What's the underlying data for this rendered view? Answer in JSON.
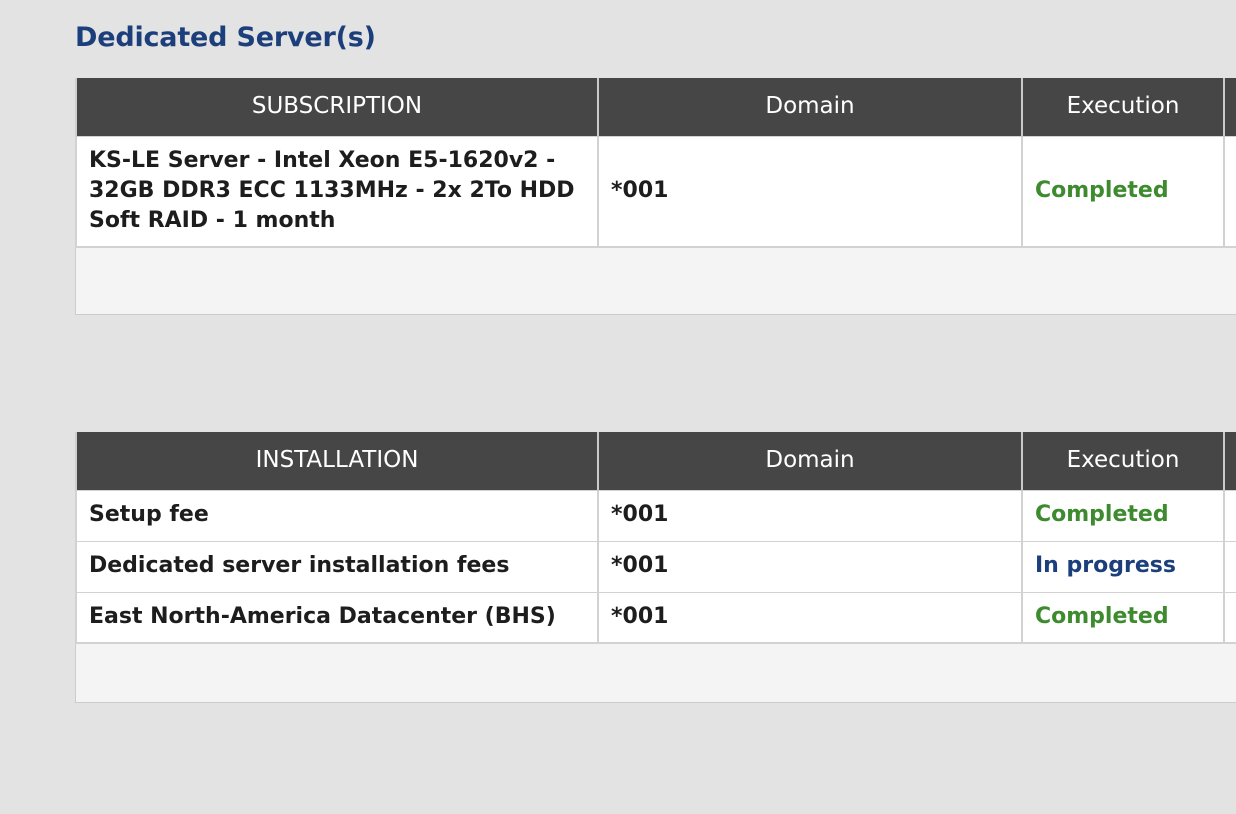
{
  "page": {
    "background_color": "#e3e3e3",
    "title": "Dedicated Server(s)",
    "title_color": "#1c3f7c"
  },
  "colors": {
    "header_bg": "#464646",
    "header_text": "#ffffff",
    "status_completed": "#3d8b2e",
    "status_in_progress": "#1c3f7c",
    "row_border": "#d2d2d2",
    "footer_bg": "#f4f4f4"
  },
  "tables": [
    {
      "name": "subscription-table",
      "columns": [
        {
          "key": "name",
          "label": "SUBSCRIPTION"
        },
        {
          "key": "domain",
          "label": "Domain"
        },
        {
          "key": "execution",
          "label": "Execution"
        },
        {
          "key": "extra",
          "label": ""
        }
      ],
      "rows": [
        {
          "name": "KS-LE Server - Intel Xeon E5-1620v2 - 32GB DDR3 ECC 1133MHz - 2x 2To HDD Soft RAID - 1 month",
          "domain": "*001",
          "execution": "Completed",
          "execution_state": "completed",
          "extra": "*"
        }
      ],
      "has_footer": true
    },
    {
      "name": "installation-table",
      "columns": [
        {
          "key": "name",
          "label": "INSTALLATION"
        },
        {
          "key": "domain",
          "label": "Domain"
        },
        {
          "key": "execution",
          "label": "Execution"
        },
        {
          "key": "extra",
          "label": ""
        }
      ],
      "rows": [
        {
          "name": "Setup fee",
          "domain": "*001",
          "execution": "Completed",
          "execution_state": "completed",
          "extra": "*"
        },
        {
          "name": "Dedicated server installation fees",
          "domain": "*001",
          "execution": "In progress",
          "execution_state": "in-progress",
          "extra": "*"
        },
        {
          "name": "East North-America Datacenter (BHS)",
          "domain": "*001",
          "execution": "Completed",
          "execution_state": "completed",
          "extra": "*"
        }
      ],
      "has_footer": true
    }
  ]
}
